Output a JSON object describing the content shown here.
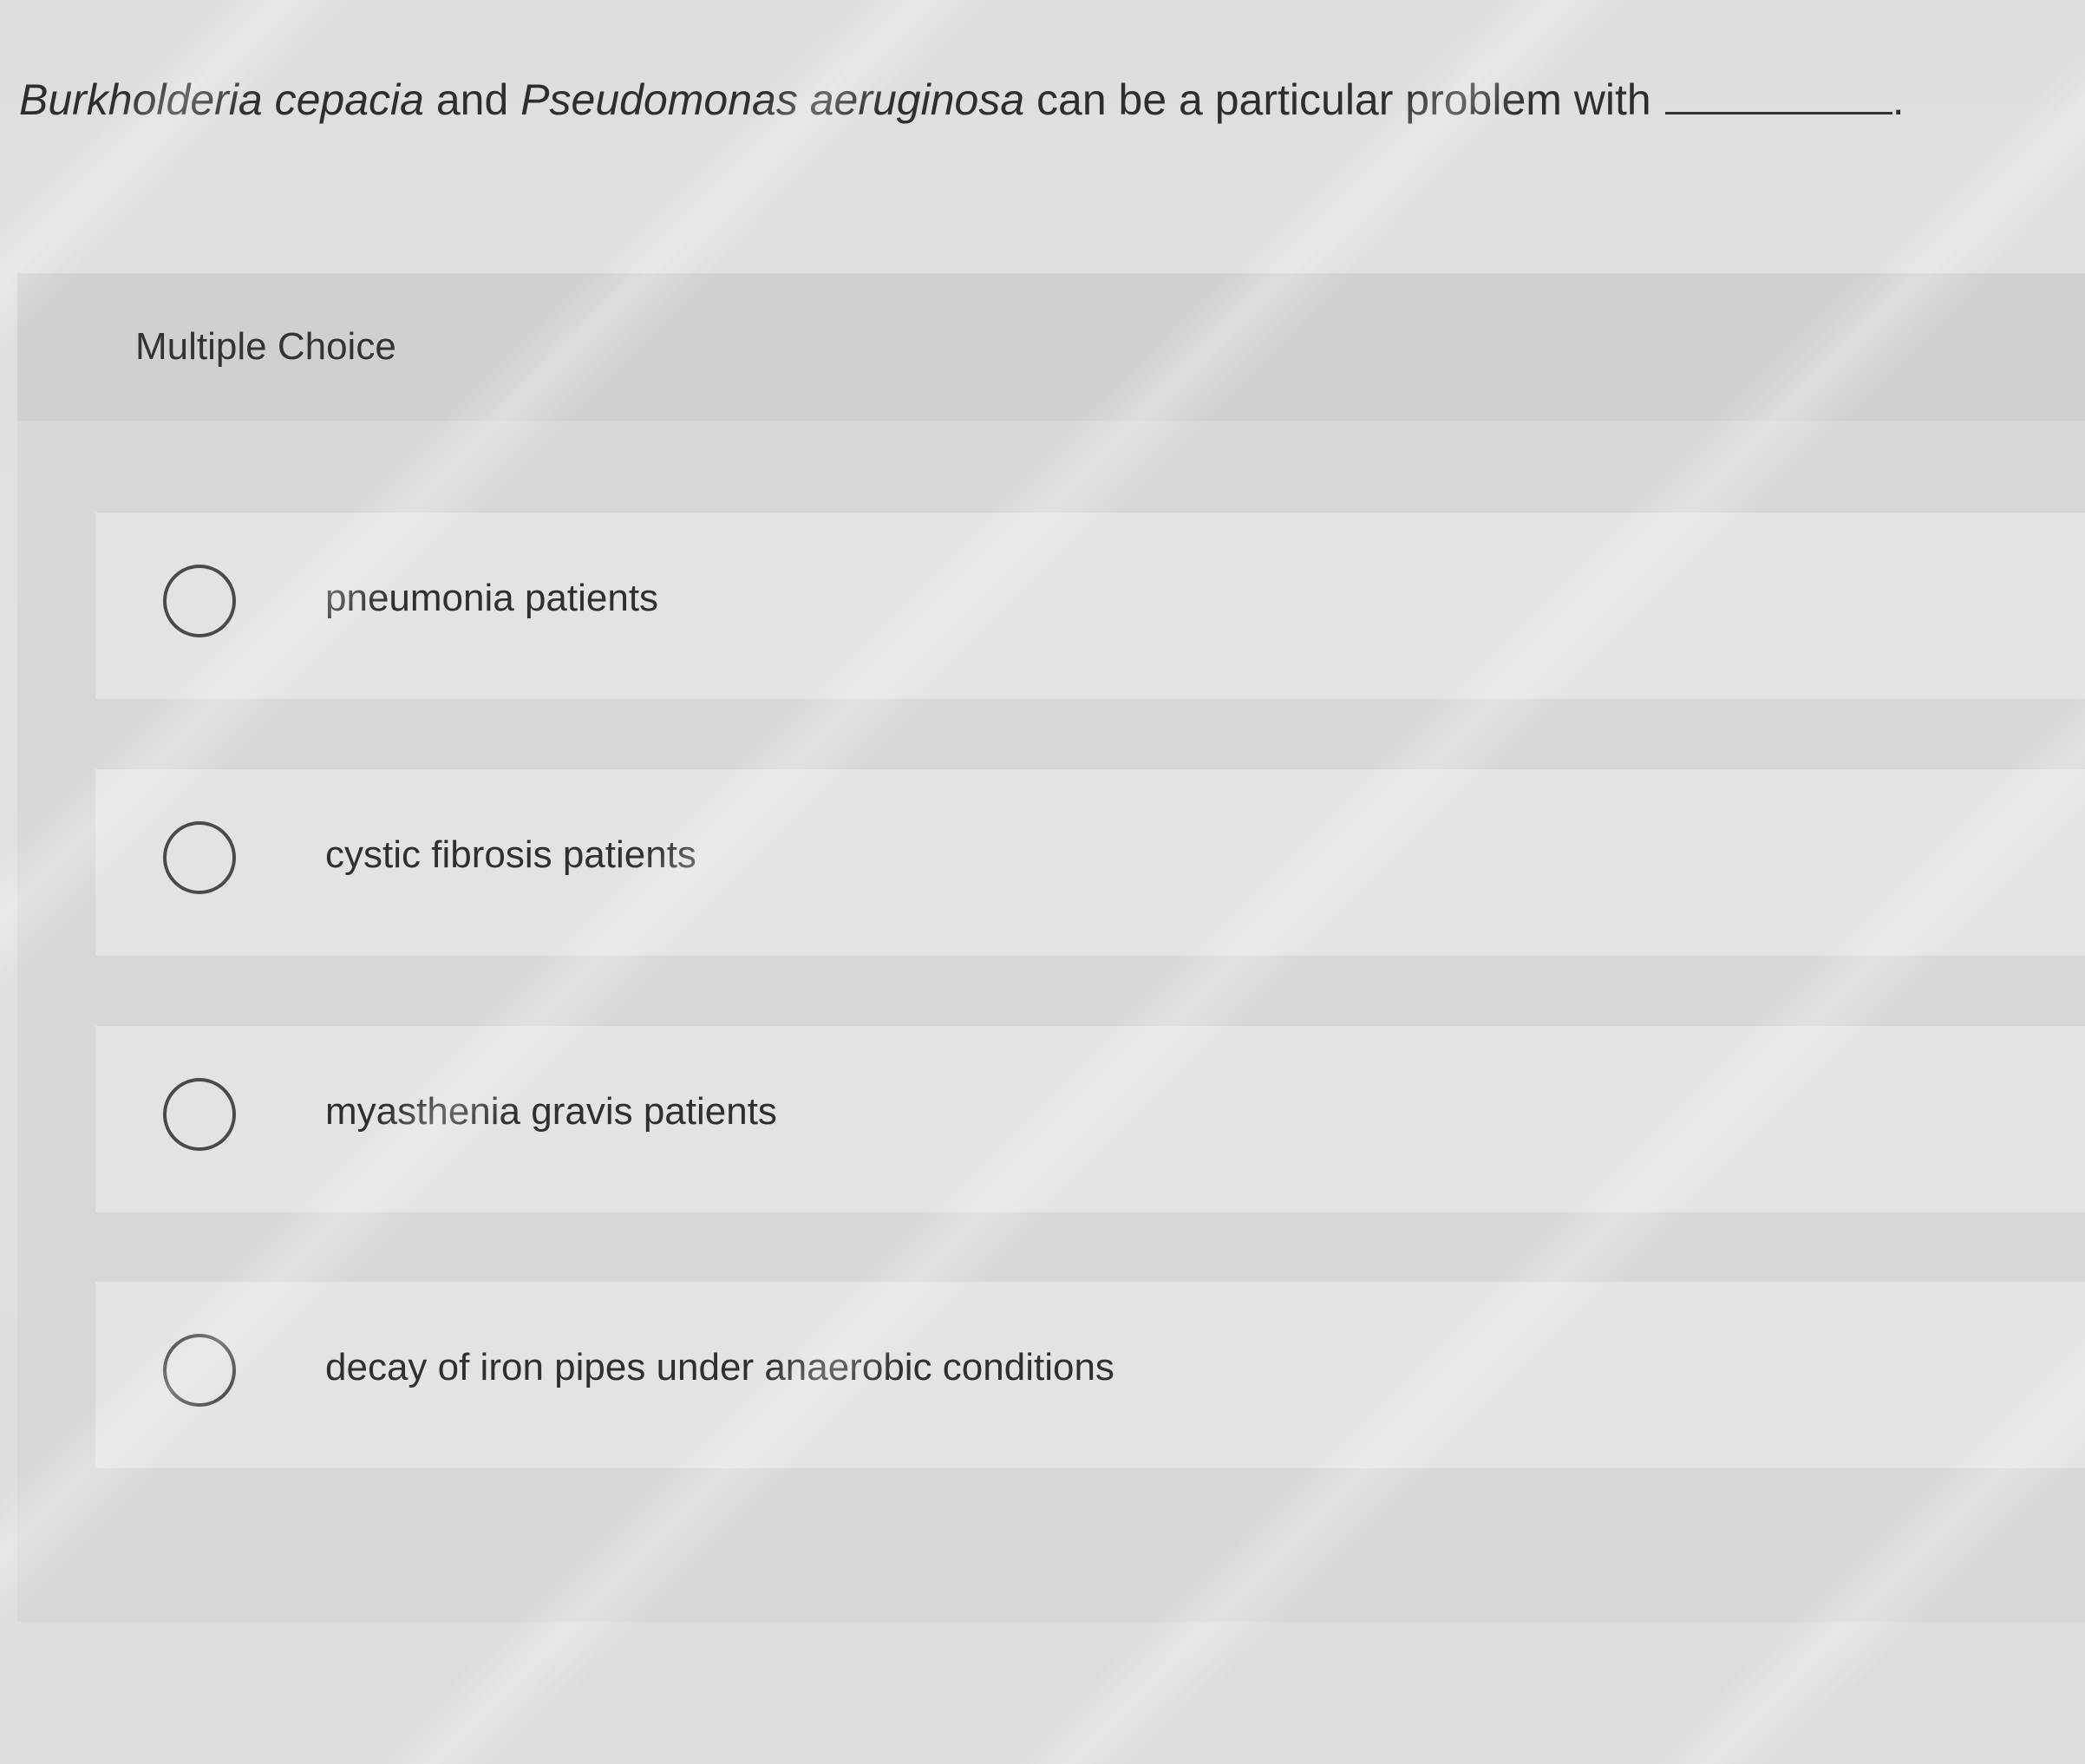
{
  "question": {
    "part1_italic": "Burkholderia cepacia",
    "part2": " and ",
    "part3_italic": "Pseudomonas aeruginosa",
    "part4": " can be a particular problem with",
    "end_punct": "."
  },
  "panel": {
    "title": "Multiple Choice"
  },
  "options": [
    {
      "label": "pneumonia patients",
      "selected": false
    },
    {
      "label": "cystic fibrosis patients",
      "selected": false
    },
    {
      "label": "myasthenia gravis patients",
      "selected": false
    },
    {
      "label": "decay of iron pipes under anaerobic conditions",
      "selected": false
    }
  ]
}
